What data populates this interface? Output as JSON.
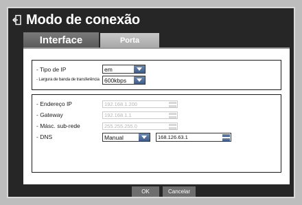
{
  "title": "Modo de conexão",
  "tabs": [
    {
      "label": "Interface",
      "active": true
    },
    {
      "label": "Porta",
      "active": false
    }
  ],
  "group1": {
    "ip_type": {
      "label": "- Tipo de IP",
      "value": "em"
    },
    "bandwidth": {
      "label": "- Largura de banda de transferência",
      "value": "600kbps"
    }
  },
  "group2": {
    "ip_address": {
      "label": "- Endereço IP",
      "value": "192.168.1.200"
    },
    "gateway": {
      "label": "- Gateway",
      "value": "192.168.1.1"
    },
    "subnet": {
      "label": "- Másc. sub-rede",
      "value": "255.255.255.0"
    },
    "dns": {
      "label": "- DNS",
      "mode": "Manual",
      "value": "168.126.63.1"
    }
  },
  "buttons": {
    "ok": "OK",
    "cancel": "Cancelar"
  },
  "colors": {
    "dropdown_accent": "#3d5d8e",
    "window_bg": "#262626",
    "tab_active": "#6a6a6a"
  },
  "icons": {
    "title": "exit-arrow-icon"
  }
}
